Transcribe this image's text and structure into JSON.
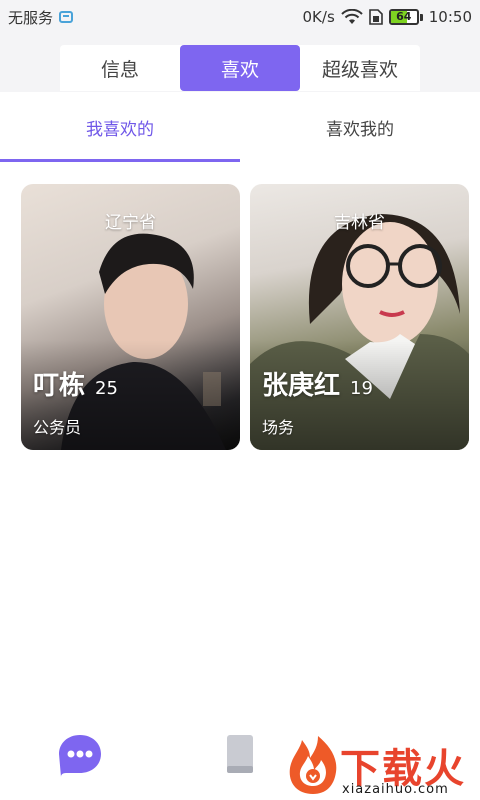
{
  "status_bar": {
    "carrier": "无服务",
    "speed": "0K/s",
    "battery_level": "64",
    "battery_fraction": 0.64,
    "time": "10:50",
    "colors": {
      "battery_fill": "#7ed321"
    }
  },
  "top_tabs": {
    "items": [
      {
        "label": "信息",
        "active": false
      },
      {
        "label": "喜欢",
        "active": true
      },
      {
        "label": "超级喜欢",
        "active": false
      }
    ],
    "accent_color": "#7e66f0"
  },
  "sub_tabs": {
    "items": [
      {
        "label": "我喜欢的",
        "active": true
      },
      {
        "label": "喜欢我的",
        "active": false
      }
    ]
  },
  "cards": [
    {
      "province": "辽宁省",
      "name": "叮栋",
      "age": "25",
      "job": "公务员"
    },
    {
      "province": "吉林省",
      "name": "张庚红",
      "age": "19",
      "job": "场务"
    }
  ],
  "bottom_nav": {
    "items": [
      {
        "icon": "chat-bubble-icon"
      },
      {
        "icon": "book-icon"
      }
    ],
    "watermark": {
      "text": "下载火",
      "subtext": "xiazaihuo.com"
    }
  }
}
